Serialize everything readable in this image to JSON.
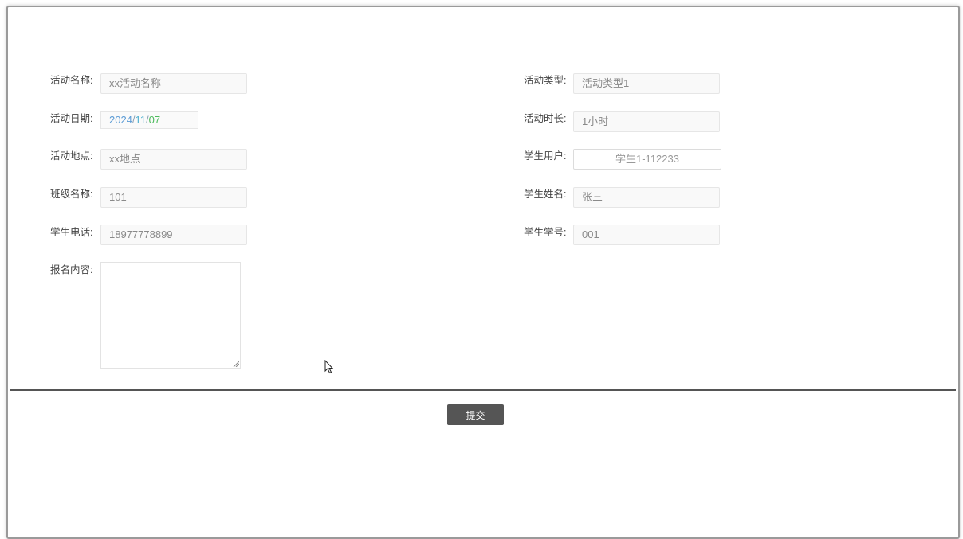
{
  "form": {
    "activity_name": {
      "label": "活动名称:",
      "value": "xx活动名称"
    },
    "activity_type": {
      "label": "活动类型:",
      "value": "活动类型1"
    },
    "activity_date": {
      "label": "活动日期:",
      "year": "2024",
      "month": "11",
      "day": "07",
      "separator": "/"
    },
    "activity_duration": {
      "label": "活动时长:",
      "value": "1小时"
    },
    "activity_location": {
      "label": "活动地点:",
      "value": "xx地点"
    },
    "student_user": {
      "label": "学生用户:",
      "value": "学生1-112233"
    },
    "class_name": {
      "label": "班级名称:",
      "value": "101"
    },
    "student_name": {
      "label": "学生姓名:",
      "value": "张三"
    },
    "student_phone": {
      "label": "学生电话:",
      "value": "18977778899"
    },
    "student_id": {
      "label": "学生学号:",
      "value": "001"
    },
    "signup_content": {
      "label": "报名内容:",
      "value": ""
    }
  },
  "actions": {
    "submit_label": "提交"
  },
  "colors": {
    "divider": "#555555",
    "submit_bg": "#555555",
    "field_bg": "#f9f9f9"
  }
}
